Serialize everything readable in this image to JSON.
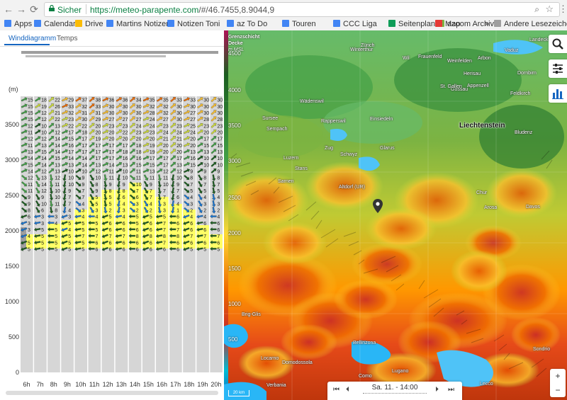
{
  "browser": {
    "secure_label": "Sicher",
    "url_host": "https://meteo-parapente.com",
    "url_path": "/#/46.7455,8.9044,9",
    "bookmarks": [
      {
        "label": "Apps",
        "icon": "apps-grid-icon",
        "color": "#4285f4"
      },
      {
        "label": "Calendar",
        "icon": "calendar-icon",
        "color": "#4285f4"
      },
      {
        "label": "Drive",
        "icon": "drive-icon",
        "color": "#fbbc05"
      },
      {
        "label": "Martins Notizen",
        "icon": "doc-icon",
        "color": "#4285f4"
      },
      {
        "label": "Notizen Toni",
        "icon": "doc-icon",
        "color": "#4285f4"
      },
      {
        "label": "az To Do",
        "icon": "doc-icon",
        "color": "#4285f4"
      },
      {
        "label": "Touren",
        "icon": "doc-icon",
        "color": "#4285f4"
      },
      {
        "label": "CCC Liga",
        "icon": "doc-icon",
        "color": "#4285f4"
      },
      {
        "label": "Seitenplan",
        "icon": "sheet-icon",
        "color": "#0f9d58"
      },
      {
        "label": "azoom Archiv",
        "icon": "azoom-icon",
        "color": "#7cb342"
      },
      {
        "label": "Map",
        "icon": "swiss-flag-icon",
        "color": "#e53935"
      }
    ],
    "other_bookmarks": "Andere Lesezeichen",
    "overflow": "»"
  },
  "tabs": [
    {
      "label": "Winddiagramm",
      "active": true
    },
    {
      "label": "Temps",
      "active": false
    }
  ],
  "diagram": {
    "unit_label": "(m)",
    "y_ticks": [
      "3500",
      "3000",
      "2500",
      "2000",
      "1500",
      "1000",
      "500",
      "0"
    ],
    "hours": [
      "6h",
      "7h",
      "8h",
      "9h",
      "10h",
      "11h",
      "12h",
      "13h",
      "14h",
      "15h",
      "16h",
      "17h",
      "18h",
      "19h",
      "20h"
    ],
    "row_speeds": [
      [
        15,
        18,
        22,
        29,
        37,
        38,
        36,
        36,
        34,
        35,
        35,
        33,
        33,
        30,
        30
      ],
      [
        15,
        19,
        26,
        33,
        32,
        33,
        30,
        30,
        30,
        32,
        32,
        30,
        30,
        30,
        30
      ],
      [
        15,
        12,
        21,
        32,
        31,
        31,
        30,
        30,
        30,
        28,
        32,
        30,
        27,
        30,
        30
      ],
      [
        15,
        12,
        22,
        23,
        30,
        29,
        27,
        27,
        27,
        24,
        27,
        30,
        27,
        28,
        28
      ],
      [
        12,
        10,
        13,
        22,
        22,
        20,
        23,
        23,
        24,
        24,
        23,
        23,
        25,
        23,
        23
      ],
      [
        11,
        10,
        12,
        17,
        18,
        20,
        20,
        22,
        23,
        23,
        24,
        24,
        24,
        20,
        20
      ],
      [
        12,
        12,
        14,
        15,
        17,
        19,
        20,
        20,
        20,
        20,
        21,
        21,
        20,
        17,
        17
      ],
      [
        11,
        13,
        14,
        16,
        17,
        17,
        17,
        17,
        18,
        19,
        20,
        20,
        20,
        15,
        15
      ],
      [
        13,
        15,
        14,
        17,
        17,
        17,
        17,
        18,
        18,
        19,
        20,
        20,
        13,
        13,
        13
      ],
      [
        14,
        14,
        15,
        14,
        14,
        17,
        17,
        16,
        16,
        17,
        17,
        17,
        16,
        10,
        10
      ],
      [
        15,
        14,
        13,
        13,
        14,
        13,
        14,
        13,
        15,
        15,
        17,
        13,
        15,
        10,
        10
      ],
      [
        14,
        12,
        13,
        10,
        10,
        12,
        11,
        10,
        11,
        13,
        12,
        12,
        9,
        9,
        9
      ],
      [
        12,
        13,
        12,
        10,
        9,
        10,
        11,
        10,
        11,
        11,
        11,
        10,
        8,
        8,
        8
      ],
      [
        11,
        14,
        11,
        10,
        9,
        8,
        9,
        9,
        10,
        9,
        10,
        9,
        7,
        7,
        7
      ],
      [
        11,
        12,
        10,
        9,
        7,
        9,
        8,
        8,
        7,
        7,
        7,
        7,
        5,
        5,
        5
      ],
      [
        9,
        9,
        10,
        7,
        7,
        5,
        5,
        6,
        6,
        7,
        7,
        6,
        4,
        4,
        4
      ],
      [
        9,
        10,
        11,
        7,
        4,
        5,
        5,
        4,
        3,
        4,
        3,
        4,
        3,
        3,
        3
      ],
      [
        8,
        6,
        8,
        4,
        3,
        3,
        2,
        3,
        2,
        2,
        3,
        1,
        2,
        2,
        2
      ],
      [
        6,
        3,
        3,
        3,
        4,
        4,
        5,
        4,
        5,
        5,
        5,
        6,
        4,
        4,
        4
      ],
      [
        3,
        3,
        4,
        5,
        5,
        5,
        6,
        6,
        5,
        6,
        7,
        6,
        6,
        6,
        6
      ],
      [
        3,
        5,
        5,
        4,
        5,
        5,
        6,
        6,
        6,
        6,
        7,
        7,
        6,
        6,
        6
      ],
      [
        4,
        5,
        5,
        5,
        7,
        7,
        7,
        7,
        8,
        8,
        8,
        8,
        7,
        7,
        7
      ],
      [
        5,
        5,
        5,
        5,
        5,
        6,
        6,
        6,
        6,
        6,
        7,
        6,
        6,
        6,
        6
      ],
      [
        5,
        5,
        5,
        5,
        5,
        6,
        6,
        6,
        6,
        6,
        6,
        6,
        5,
        5,
        5
      ]
    ]
  },
  "map": {
    "legend_line1": "Grenzschicht",
    "legend_line2": "Decke",
    "legend_line3": "m MSL",
    "scale_labels": [
      "4500",
      "4000",
      "3500",
      "3000",
      "2500",
      "2000",
      "1500",
      "1000",
      "500"
    ],
    "region_label": "Liechtenstein",
    "place_labels": [
      "Zürich",
      "Winterthur",
      "Wil",
      "Frauenfeld",
      "Weinfelden",
      "Arbon",
      "Gossau",
      "Herisau",
      "St. Gallen",
      "Appenzell",
      "Sursee",
      "Sempach",
      "Luzern",
      "Zug",
      "Schwyz",
      "Altdorf (UR)",
      "Glarus",
      "Sarnen",
      "Stans",
      "Chur",
      "Davos",
      "Brig-Glis",
      "Locarno",
      "Bellinzona",
      "Lugano",
      "Domodossola",
      "Como",
      "Sondrio",
      "Verbania",
      "Lecco",
      "Vaduz",
      "Rapperswil",
      "Wädenswil",
      "Einsiedeln",
      "Dornbirn",
      "Feldkirch",
      "Bludenz",
      "Arosa",
      "Landeck"
    ],
    "scale_bar": "20 km",
    "time_label": "Sa. 11. - 14:00",
    "zoom_in": "+",
    "zoom_out": "−",
    "colors": {
      "low": "#2e7d32",
      "mid": "#fdd835",
      "high": "#c62828",
      "lake": "#29b6f6"
    }
  }
}
